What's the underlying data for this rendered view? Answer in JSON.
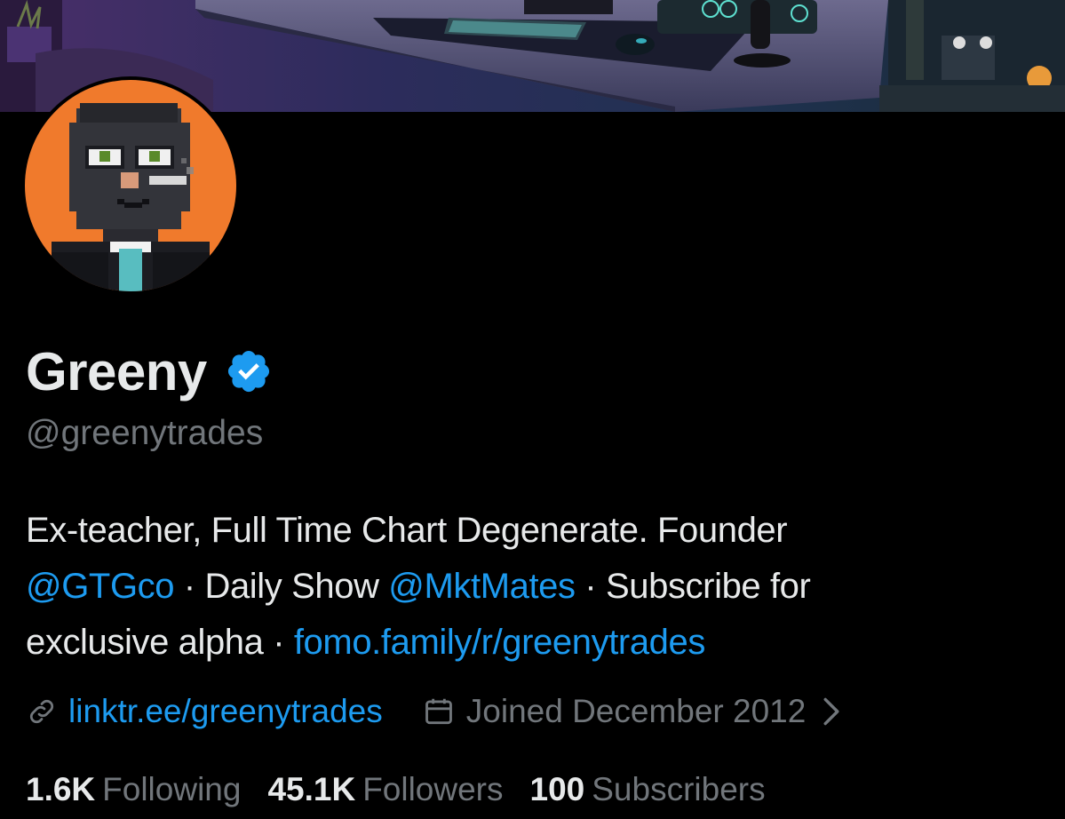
{
  "profile": {
    "display_name": "Greeny",
    "handle": "@greenytrades",
    "verified_icon": "verified-badge-icon",
    "bio": {
      "line1_text": "Ex-teacher, Full Time Chart Degenerate. Founder",
      "mention1": "@GTGco",
      "sep1": " · Daily Show ",
      "mention2": "@MktMates",
      "sep2": " · Subscribe for",
      "line3_text": "exclusive alpha · ",
      "bio_link": "fomo.family/r/greenytrades"
    },
    "website": "linktr.ee/greenytrades",
    "joined": "Joined December 2012",
    "stats": {
      "following_count": "1.6K",
      "following_label": "Following",
      "followers_count": "45.1K",
      "followers_label": "Followers",
      "subscribers_count": "100",
      "subscribers_label": "Subscribers"
    }
  },
  "colors": {
    "background": "#000000",
    "text_primary": "#e7e9ea",
    "text_secondary": "#71767b",
    "link": "#1d9bf0",
    "avatar_bg": "#f07a2c"
  },
  "icons": [
    "link-icon",
    "calendar-icon",
    "chevron-right-icon",
    "verified-badge-icon"
  ]
}
